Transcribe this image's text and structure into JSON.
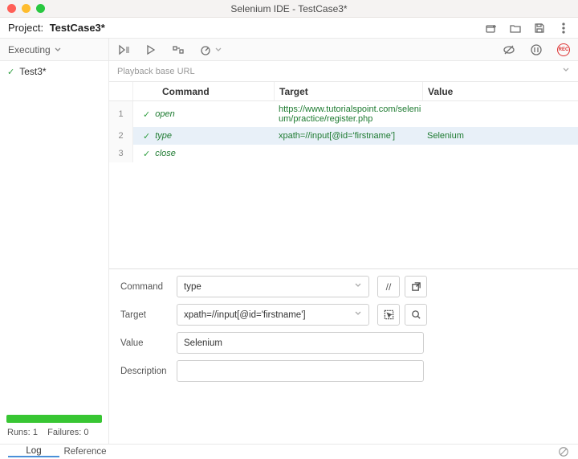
{
  "titlebar": {
    "title": "Selenium IDE - TestCase3*"
  },
  "project": {
    "label": "Project:",
    "name": "TestCase3*"
  },
  "sidebar": {
    "executing_label": "Executing",
    "tests": [
      {
        "name": "Test3*",
        "passed": true
      }
    ],
    "runs_label": "Runs:",
    "runs": "1",
    "failures_label": "Failures:",
    "failures": "0"
  },
  "url_input": {
    "placeholder": "Playback base URL"
  },
  "columns": {
    "command": "Command",
    "target": "Target",
    "value": "Value"
  },
  "steps": [
    {
      "n": "1",
      "command": "open",
      "target": "https://www.tutorialspoint.com/selenium/practice/register.php",
      "value": "",
      "selected": false,
      "multi": true
    },
    {
      "n": "2",
      "command": "type",
      "target": "xpath=//input[@id='firstname']",
      "value": "Selenium",
      "selected": true,
      "multi": false
    },
    {
      "n": "3",
      "command": "close",
      "target": "",
      "value": "",
      "selected": false,
      "multi": false
    }
  ],
  "editor": {
    "command_label": "Command",
    "command_value": "type",
    "target_label": "Target",
    "target_value": "xpath=//input[@id='firstname']",
    "value_label": "Value",
    "value_value": "Selenium",
    "description_label": "Description",
    "description_value": "",
    "disable_btn": "//"
  },
  "footer": {
    "log": "Log",
    "reference": "Reference"
  }
}
